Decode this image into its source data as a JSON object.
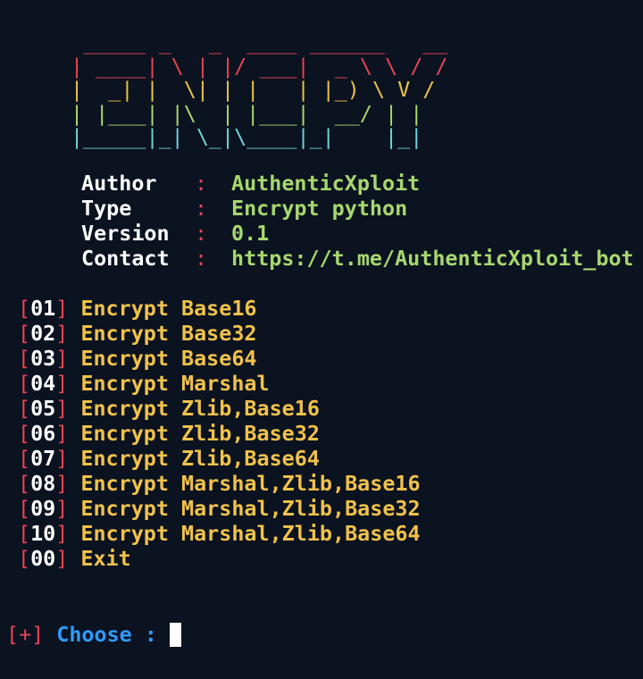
{
  "banner": {
    "lines": [
      " _____ _   _  ____ ______   __",
      "| ____| \\ | |/ ___|  _ \\ \\ / /",
      "|  _| |  \\| | |   | |_) \\ V / ",
      "| |___| |\\  | |___|  __/ | |  ",
      "|_____|_| \\_|\\____|_|    |_|  "
    ]
  },
  "info": [
    {
      "key": "Author",
      "sep": ":",
      "value": "AuthenticXploit"
    },
    {
      "key": "Type",
      "sep": ":",
      "value": "Encrypt python"
    },
    {
      "key": "Version",
      "sep": ":",
      "value": "0.1"
    },
    {
      "key": "Contact",
      "sep": ":",
      "value": "https://t.me/AuthenticXploit_bot"
    }
  ],
  "menu": [
    {
      "num": "01",
      "label": "Encrypt Base16"
    },
    {
      "num": "02",
      "label": "Encrypt Base32"
    },
    {
      "num": "03",
      "label": "Encrypt Base64"
    },
    {
      "num": "04",
      "label": "Encrypt Marshal"
    },
    {
      "num": "05",
      "label": "Encrypt Zlib,Base16"
    },
    {
      "num": "06",
      "label": "Encrypt Zlib,Base32"
    },
    {
      "num": "07",
      "label": "Encrypt Zlib,Base64"
    },
    {
      "num": "08",
      "label": "Encrypt Marshal,Zlib,Base16"
    },
    {
      "num": "09",
      "label": "Encrypt Marshal,Zlib,Base32"
    },
    {
      "num": "10",
      "label": "Encrypt Marshal,Zlib,Base64"
    },
    {
      "num": "00",
      "label": "Exit"
    }
  ],
  "brackets": {
    "open": "[",
    "close": "]"
  },
  "prompt": {
    "marker": "[+]",
    "label": "Choose",
    "colon": ":",
    "input_value": ""
  },
  "colors": {
    "background": "#0b1220",
    "red": "#e64553",
    "yellow": "#f0c24a",
    "green": "#a6d86e",
    "cyan": "#6fd3d8",
    "blue": "#2f9bff",
    "white": "#ffffff"
  }
}
